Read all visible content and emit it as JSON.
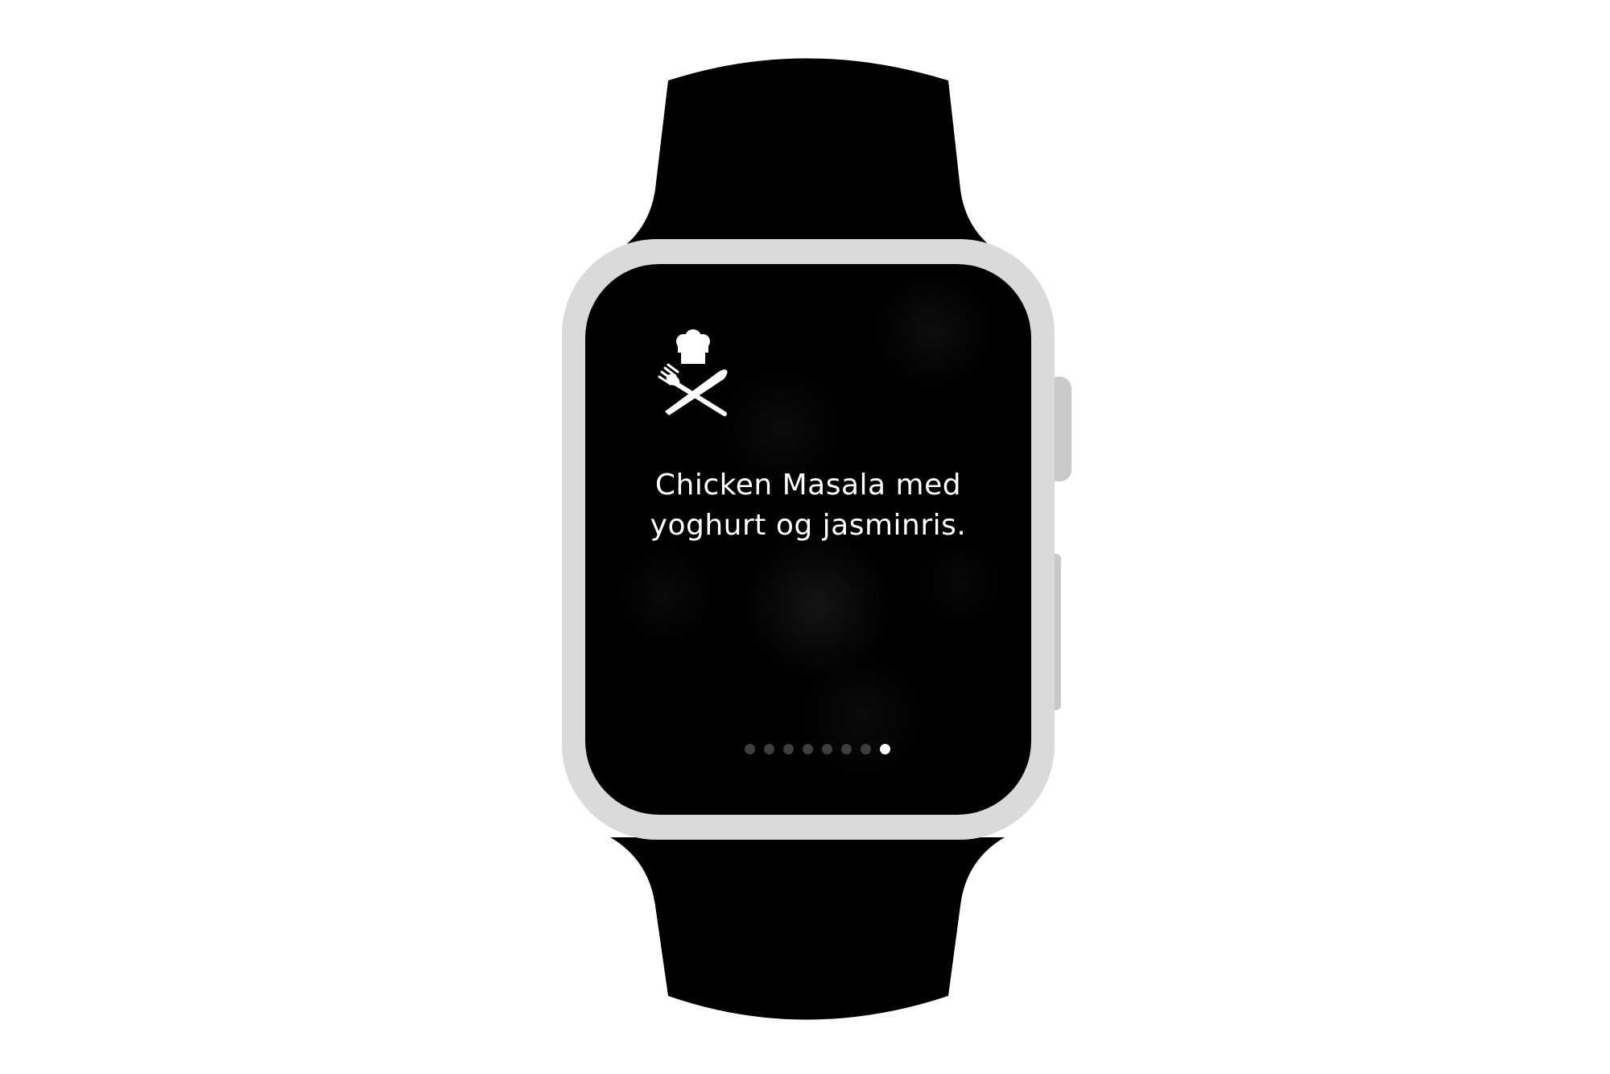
{
  "screen": {
    "message_line_1": "Chicken Masala med",
    "message_line_2": "yoghurt og jasminris."
  },
  "app_icon": "chef-hat-cutlery-icon",
  "page_indicator": {
    "count": 8,
    "current": 8
  },
  "colors": {
    "strap": "#000000",
    "case": "#d9dada",
    "buttons": "#c9c9c9",
    "screen": "#000000",
    "text": "#ffffff",
    "dot_inactive": "#3e3e3e",
    "dot_active": "#ffffff"
  }
}
